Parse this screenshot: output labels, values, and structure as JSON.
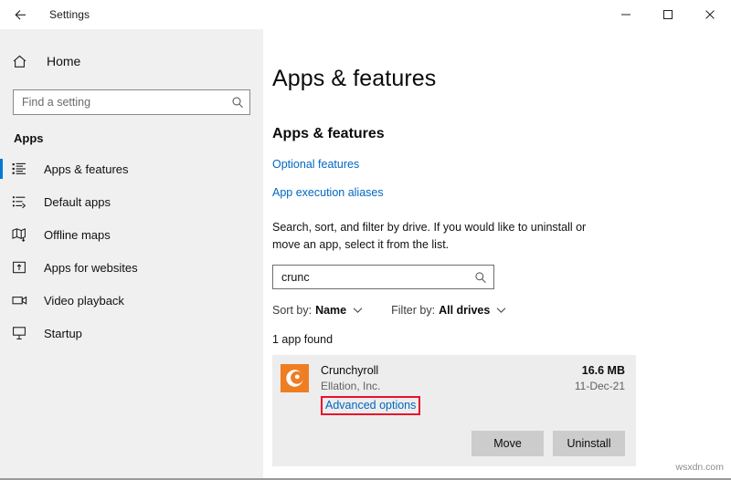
{
  "window": {
    "title": "Settings",
    "back_icon": "back-arrow-icon",
    "minimize_label": "—",
    "maximize_label": "□",
    "close_label": "✕"
  },
  "sidebar": {
    "home_label": "Home",
    "home_icon": "home-icon",
    "search": {
      "placeholder": "Find a setting",
      "icon": "search-icon",
      "value": ""
    },
    "section_title": "Apps",
    "items": [
      {
        "label": "Apps & features",
        "icon": "apps-list-icon",
        "selected": true
      },
      {
        "label": "Default apps",
        "icon": "default-apps-icon",
        "selected": false
      },
      {
        "label": "Offline maps",
        "icon": "offline-maps-icon",
        "selected": false
      },
      {
        "label": "Apps for websites",
        "icon": "apps-for-websites-icon",
        "selected": false
      },
      {
        "label": "Video playback",
        "icon": "video-playback-icon",
        "selected": false
      },
      {
        "label": "Startup",
        "icon": "startup-icon",
        "selected": false
      }
    ]
  },
  "main": {
    "page_title": "Apps & features",
    "section_heading": "Apps & features",
    "links": [
      {
        "label": "Optional features"
      },
      {
        "label": "App execution aliases"
      }
    ],
    "description": "Search, sort, and filter by drive. If you would like to uninstall or move an app, select it from the list.",
    "filter_search": {
      "value": "crunc",
      "placeholder": "Search this list",
      "icon": "search-icon"
    },
    "sort_by": {
      "prefix": "Sort by:",
      "value": "Name",
      "chevron": "chevron-down-icon"
    },
    "filter_by": {
      "prefix": "Filter by:",
      "value": "All drives",
      "chevron": "chevron-down-icon"
    },
    "count_text": "1 app found",
    "app": {
      "name": "Crunchyroll",
      "publisher": "Ellation, Inc.",
      "advanced_options_label": "Advanced options",
      "size": "16.6 MB",
      "install_date": "11-Dec-21",
      "icon": "crunchyroll-app-icon",
      "move_label": "Move",
      "uninstall_label": "Uninstall"
    }
  },
  "annotation": {
    "highlight_color": "#e8112d",
    "target": "Advanced options"
  },
  "colors": {
    "accent": "#0078d7",
    "link": "#0067c0",
    "sidebar_bg": "#f0f0f0",
    "card_bg": "#ededed",
    "button_bg": "#cccccc",
    "app_icon_bg": "#ef7d22"
  },
  "watermark": {
    "text": "wsxdn.com"
  }
}
